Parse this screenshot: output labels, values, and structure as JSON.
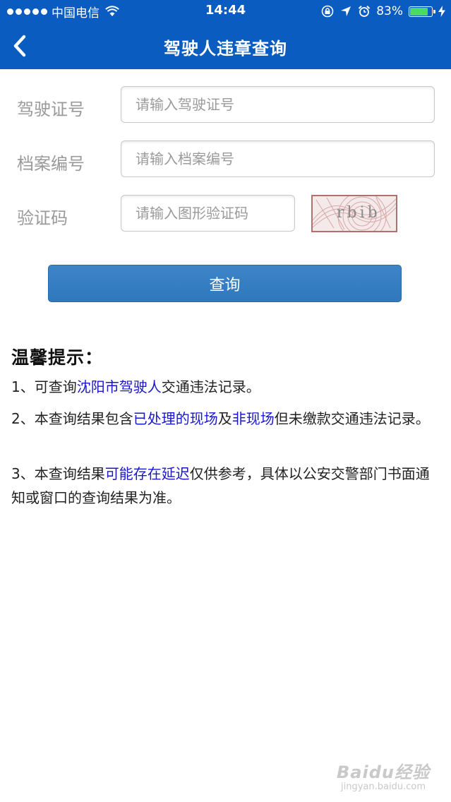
{
  "status_bar": {
    "carrier": "中国电信",
    "time": "14:44",
    "battery_percent": "83%",
    "battery_level": 0.83,
    "icons": [
      "signal-dots-icon",
      "wifi-icon",
      "rotation-lock-icon",
      "location-arrow-icon",
      "alarm-icon",
      "battery-icon",
      "charging-bolt-icon"
    ]
  },
  "nav": {
    "title": "驾驶人违章查询",
    "back_icon": "chevron-left-icon"
  },
  "form": {
    "license_label": "驾驶证号",
    "license_placeholder": "请输入驾驶证号",
    "file_label": "档案编号",
    "file_placeholder": "请输入档案编号",
    "captcha_label": "验证码",
    "captcha_placeholder": "请输入图形验证码",
    "captcha_text": "rbib",
    "submit_label": "查询"
  },
  "tips": {
    "title": "温馨提示：",
    "items": [
      {
        "a": "1、可查询",
        "b": "沈阳市驾驶人",
        "c": "交通违法记录。"
      },
      {
        "a": "2、本查询结果包含",
        "b": "已处理的现场",
        "c": "及",
        "d": "非现场",
        "e": "但未缴款交通违法记录。"
      },
      {
        "a": "3、本查询结果",
        "b": "可能存在延迟",
        "c": "仅供参考，具体以公安交警部门书面通知或窗口的查询结果为准。"
      }
    ]
  },
  "colors": {
    "header": "#0b5cc0",
    "button": "#3d85c6",
    "highlight": "#1a17c9"
  },
  "watermark": {
    "main": "Baidu经验",
    "sub": "jingyan.baidu.com"
  }
}
